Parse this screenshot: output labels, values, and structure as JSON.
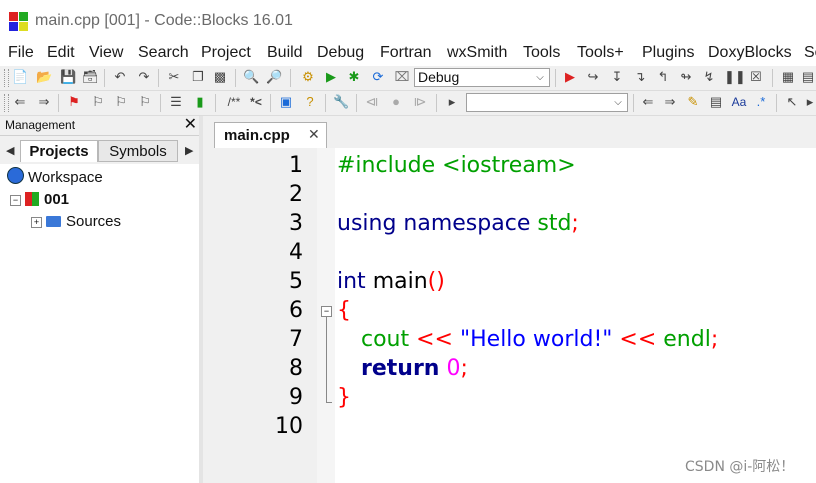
{
  "window": {
    "title": "main.cpp [001] - Code::Blocks 16.01"
  },
  "menu": [
    "File",
    "Edit",
    "View",
    "Search",
    "Project",
    "Build",
    "Debug",
    "Fortran",
    "wxSmith",
    "Tools",
    "Tools+",
    "Plugins",
    "DoxyBlocks",
    "Se"
  ],
  "toolbar": {
    "build_target": "Debug",
    "search_value": "",
    "comment_label": "/**",
    "comment_inline_label": "*<",
    "aa_label": "Aa"
  },
  "management": {
    "title": "Management",
    "tabs": [
      "Projects",
      "Symbols"
    ],
    "tree": {
      "workspace": "Workspace",
      "project": "001",
      "sources": "Sources"
    }
  },
  "editor": {
    "tab_label": "main.cpp",
    "line_numbers": [
      "1",
      "2",
      "3",
      "4",
      "5",
      "6",
      "7",
      "8",
      "9",
      "10"
    ],
    "lines": {
      "l1": "#include <iostream>",
      "l3_kw": "using namespace",
      "l3_std": "std",
      "l3_semi": ";",
      "l5_int": "int",
      "l5_main": "main",
      "l5_parens": "()",
      "l6_brace": "{",
      "l7_cout": "cout",
      "l7_op1": "<<",
      "l7_str": "\"Hello world!\"",
      "l7_op2": "<<",
      "l7_endl": "endl",
      "l7_semi": ";",
      "l8_return": "return",
      "l8_zero": "0",
      "l8_semi": ";",
      "l9_brace": "}"
    }
  },
  "watermark": "CSDN @i-阿松！",
  "colors": {
    "preprocessor": "#00a000",
    "keyword": "#00008b",
    "string": "#0000ff",
    "number": "#ff00ff",
    "operator": "#ff0000",
    "std": "#00a000"
  }
}
